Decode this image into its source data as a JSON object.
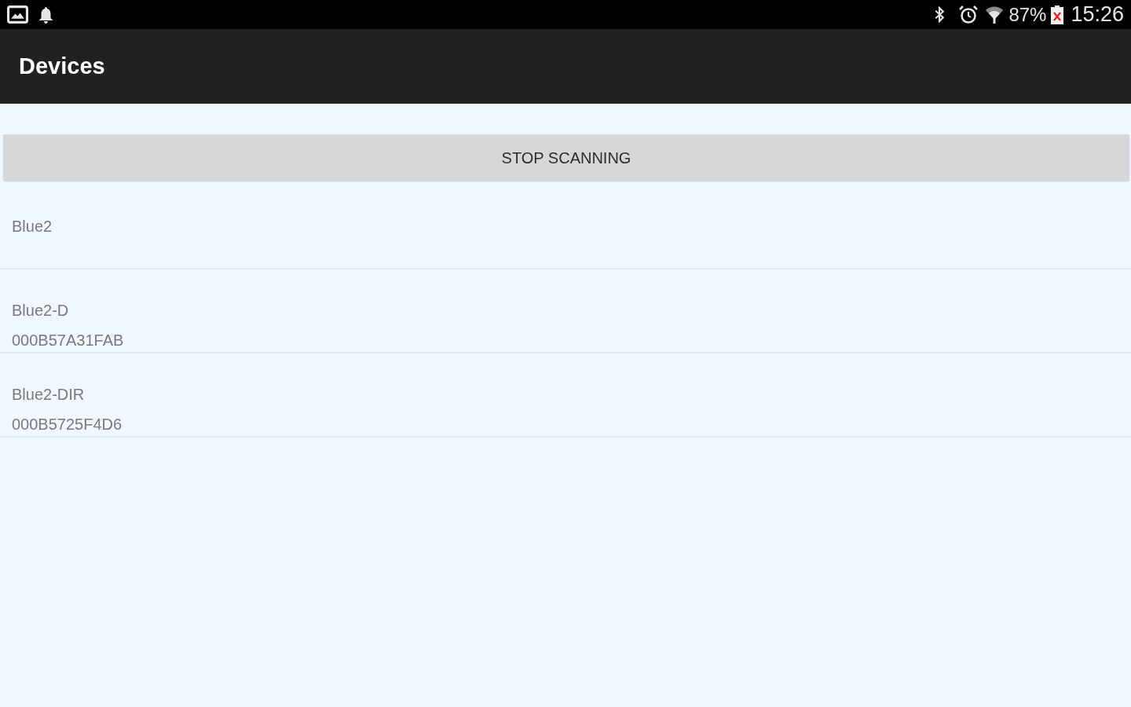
{
  "status_bar": {
    "battery": "87%",
    "time": "15:26"
  },
  "app_bar": {
    "title": "Devices"
  },
  "scan_button": {
    "label": "STOP SCANNING"
  },
  "devices": [
    {
      "name": "Blue2"
    },
    {
      "name": "Blue2-D",
      "address": "000B57A31FAB"
    },
    {
      "name": "Blue2-DIR",
      "address": "000B5725F4D6"
    }
  ]
}
